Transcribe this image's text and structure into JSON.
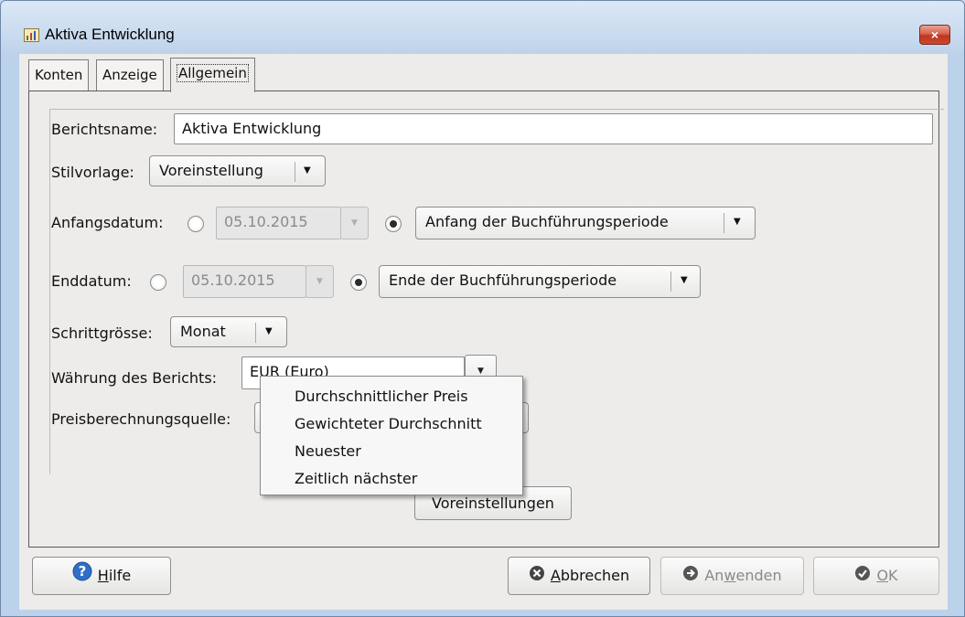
{
  "window": {
    "title": "Aktiva Entwicklung",
    "close_glyph": "×"
  },
  "tabs": [
    {
      "label": "Konten",
      "active": false
    },
    {
      "label": "Anzeige",
      "active": false
    },
    {
      "label": "Allgemein",
      "active": true
    }
  ],
  "form": {
    "report_name": {
      "label": "Berichtsname:",
      "value": "Aktiva Entwicklung"
    },
    "stylesheet": {
      "label": "Stilvorlage:",
      "value": "Voreinstellung"
    },
    "start_date": {
      "label": "Anfangsdatum:",
      "date_value": "05.10.2015",
      "relative_value": "Anfang der Buchführungsperiode",
      "relative_selected": true
    },
    "end_date": {
      "label": "Enddatum:",
      "date_value": "05.10.2015",
      "relative_value": "Ende der Buchführungsperiode",
      "relative_selected": true
    },
    "step_size": {
      "label": "Schrittgrösse:",
      "value": "Monat"
    },
    "report_currency": {
      "label": "Währung des Berichts:",
      "value": "EUR (Euro)"
    },
    "price_source": {
      "label": "Preisberechnungsquelle:"
    },
    "defaults_button": "Voreinstellungen"
  },
  "price_source_menu": {
    "items": [
      "Durchschnittlicher Preis",
      "Gewichteter Durchschnitt",
      "Neuester",
      "Zeitlich nächster"
    ]
  },
  "buttons": {
    "help": {
      "label": "Hilfe",
      "mnemonic": "H",
      "rest": "ilfe"
    },
    "cancel": {
      "label": "Abbrechen",
      "mnemonic": "A",
      "rest": "bbrechen"
    },
    "apply": {
      "label": "Anwenden",
      "pre": "An",
      "mnemonic": "w",
      "rest": "enden"
    },
    "ok": {
      "label": "OK",
      "mnemonic": "O",
      "rest": "K"
    }
  },
  "icons": {
    "app": "report-icon",
    "help": "question-icon",
    "cancel": "cancel-icon",
    "apply": "apply-arrow-icon",
    "ok": "ok-check-icon"
  },
  "colors": {
    "help_blue": "#2f6fc6",
    "close_red": "#c7412b"
  }
}
